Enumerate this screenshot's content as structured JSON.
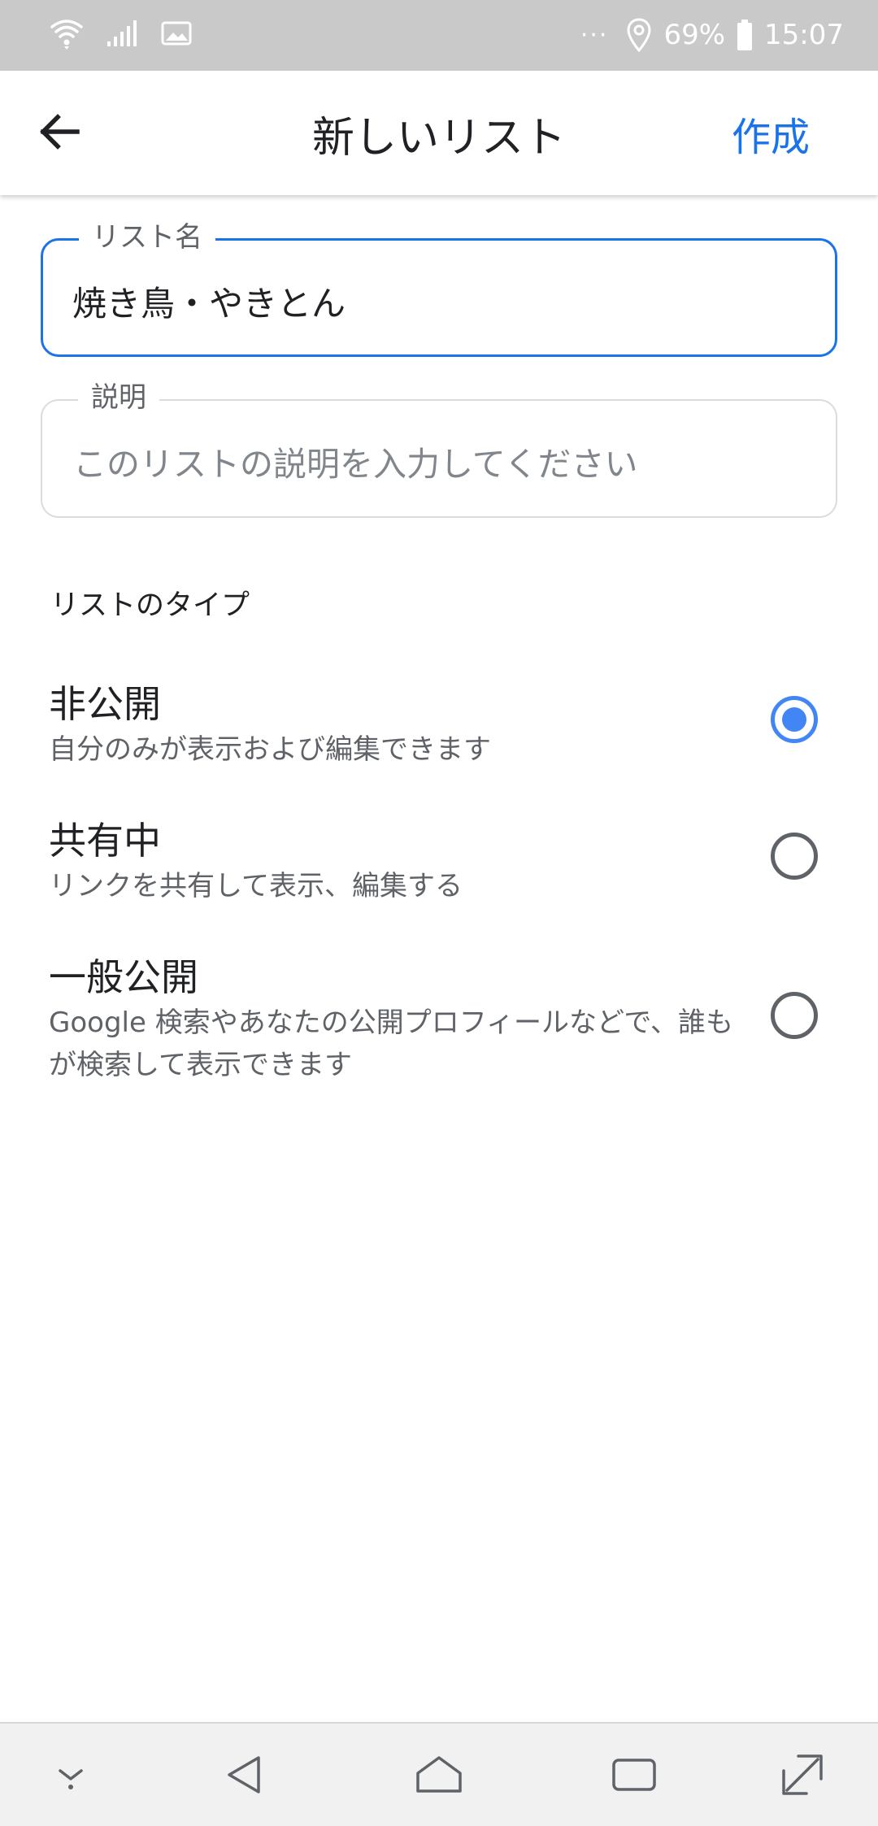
{
  "status_bar": {
    "icons": [
      "wifi-icon",
      "signal-icon",
      "gallery-icon",
      "more-icon",
      "location-icon",
      "battery-icon"
    ],
    "more_dots": "···",
    "battery": "69%",
    "time": "15:07"
  },
  "header": {
    "title": "新しいリスト",
    "create_label": "作成"
  },
  "form": {
    "name_field": {
      "label": "リスト名",
      "value": "焼き鳥・やきとん"
    },
    "description_field": {
      "label": "説明",
      "placeholder": "このリストの説明を入力してください"
    },
    "type_section_title": "リストのタイプ",
    "types": [
      {
        "title": "非公開",
        "description": "自分のみが表示および編集できます",
        "selected": true
      },
      {
        "title": "共有中",
        "description": "リンクを共有して表示、編集する",
        "selected": false
      },
      {
        "title": "一般公開",
        "description": "Google 検索やあなたの公開プロフィールなどで、誰もが検索して表示できます",
        "selected": false
      }
    ]
  },
  "colors": {
    "accent": "#1a73e8",
    "radio_selected": "#4285f4",
    "status_bar_bg": "#c9c9c9"
  },
  "nav_bar": {
    "icons": [
      "hide-keyboard-icon",
      "back-icon",
      "home-icon",
      "recents-icon",
      "expand-icon"
    ]
  }
}
